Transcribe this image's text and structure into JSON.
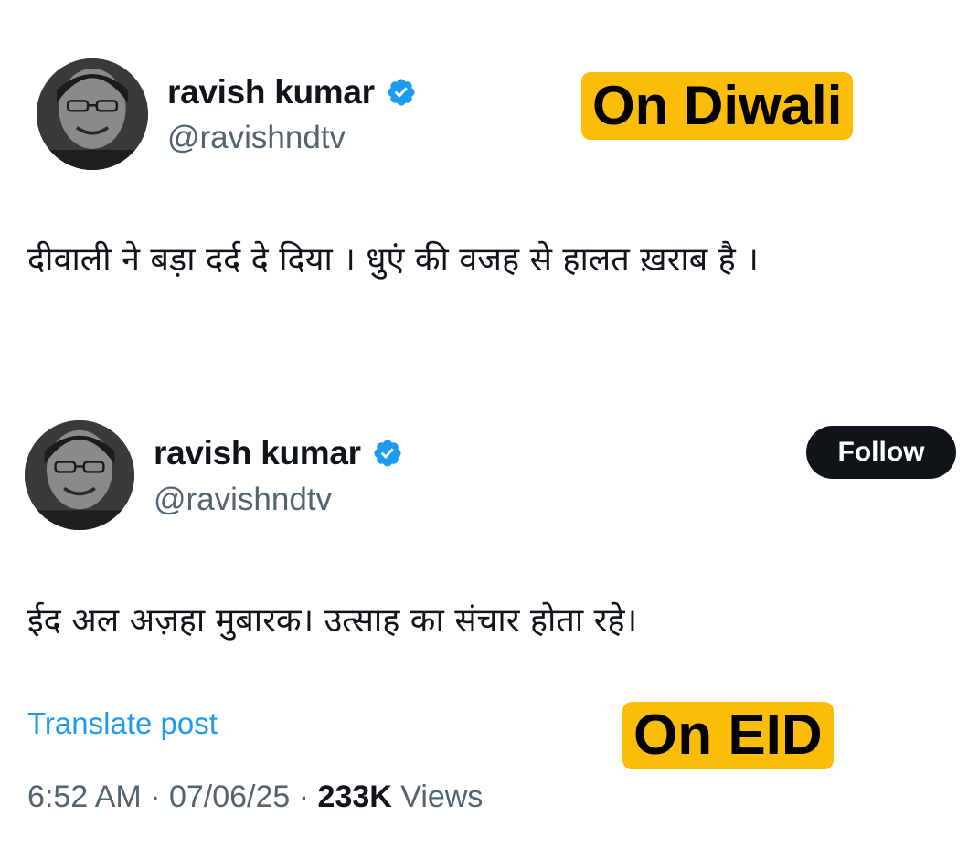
{
  "posts": [
    {
      "author": {
        "display_name": "ravish kumar",
        "handle": "@ravishndtv",
        "verified_icon": "verified-badge-icon"
      },
      "text": "दीवाली ने बड़ा दर्द दे दिया । धुएं की वजह से हालत ख़राब है ।",
      "label": "On Diwali"
    },
    {
      "author": {
        "display_name": "ravish kumar",
        "handle": "@ravishndtv",
        "verified_icon": "verified-badge-icon"
      },
      "follow_label": "Follow",
      "text": "ईद अल अज़हा मुबारक। उत्साह का संचार होता रहे।",
      "translate_label": "Translate post",
      "time": "6:52 AM",
      "separator": " · ",
      "date": "07/06/25",
      "views_count": "233K",
      "views_label": " Views",
      "label": "On EID"
    }
  ],
  "colors": {
    "label_bg": "#fbbd08",
    "verified": "#1d9bf0",
    "link": "#1d9bf0",
    "secondary_text": "#536471",
    "primary_text": "#0f1419"
  }
}
